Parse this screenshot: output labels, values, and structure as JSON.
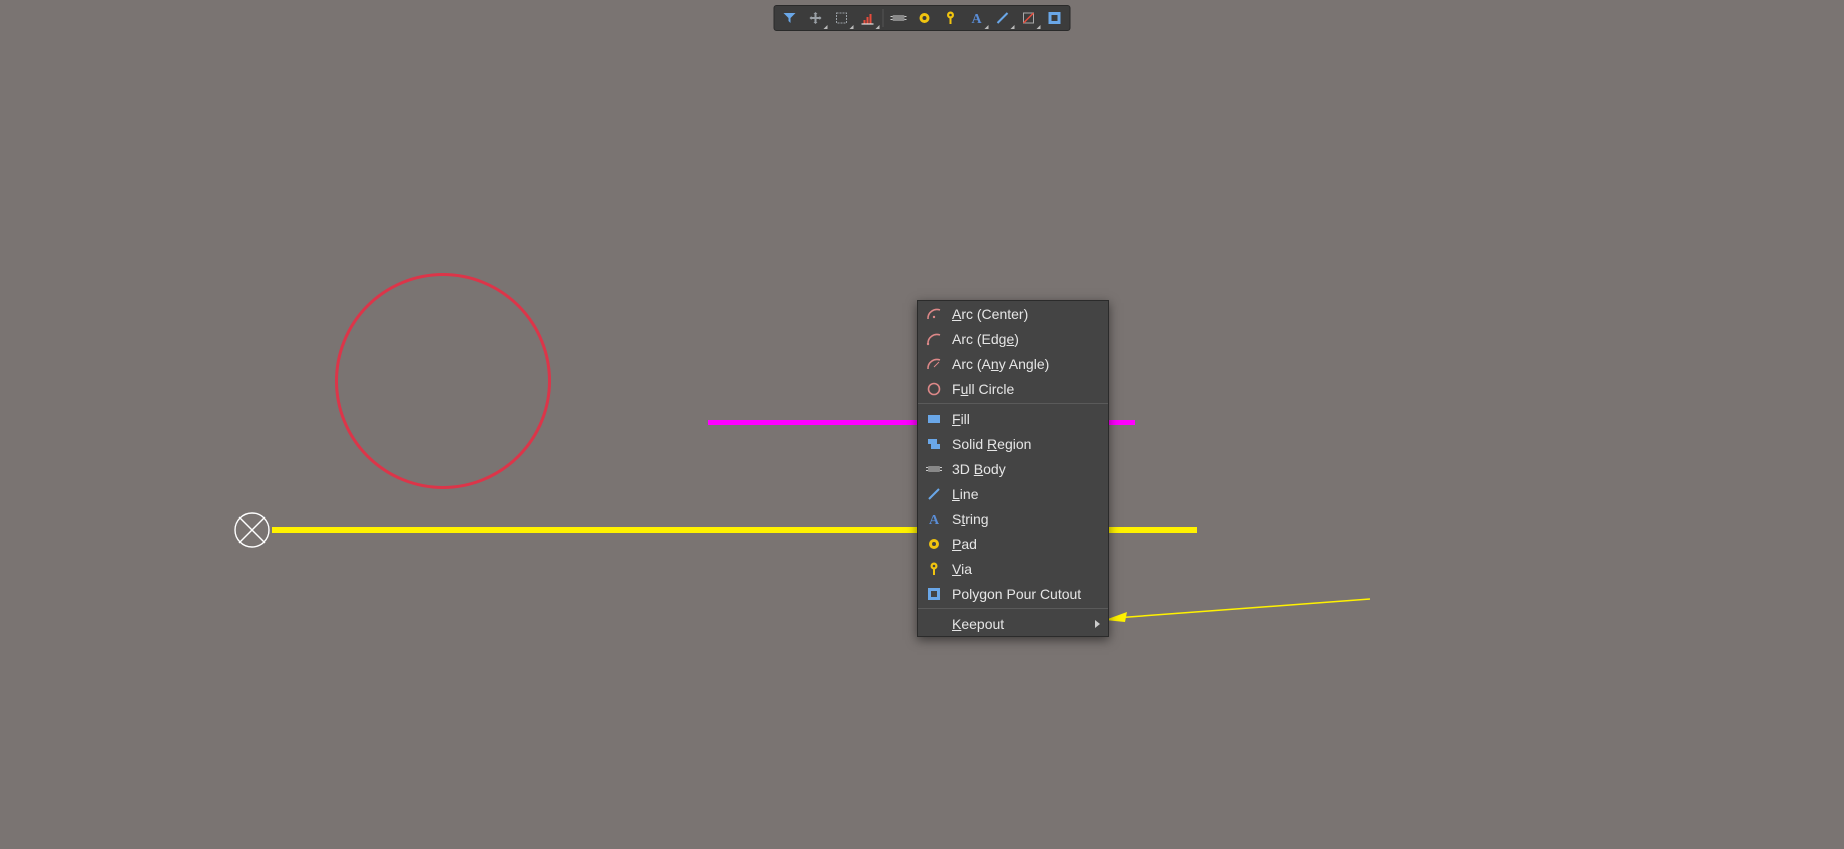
{
  "toolbar": {
    "items": [
      {
        "name": "filter-icon",
        "dropdown": false
      },
      {
        "name": "move-icon",
        "dropdown": true
      },
      {
        "name": "selection-icon",
        "dropdown": true
      },
      {
        "name": "align-icon",
        "dropdown": true
      },
      {
        "sep": true
      },
      {
        "name": "component-icon",
        "dropdown": false
      },
      {
        "name": "pad-icon",
        "dropdown": false
      },
      {
        "name": "via-icon",
        "dropdown": false
      },
      {
        "name": "text-icon",
        "dropdown": true
      },
      {
        "name": "line-icon",
        "dropdown": true
      },
      {
        "name": "shape-icon",
        "dropdown": true
      },
      {
        "name": "polygon-pour-cutout-icon",
        "dropdown": false
      }
    ]
  },
  "context_menu": {
    "groups": [
      {
        "items": [
          {
            "icon": "arc-center-icon",
            "label_pre": "",
            "label_u": "A",
            "label_post": "rc (Center)"
          },
          {
            "icon": "arc-edge-icon",
            "label_pre": "Arc (Edg",
            "label_u": "e",
            "label_post": ")"
          },
          {
            "icon": "arc-any-icon",
            "label_pre": "Arc (A",
            "label_u": "n",
            "label_post": "y Angle)"
          },
          {
            "icon": "full-circle-icon",
            "label_pre": "F",
            "label_u": "u",
            "label_post": "ll Circle"
          }
        ]
      },
      {
        "items": [
          {
            "icon": "fill-icon",
            "label_pre": "",
            "label_u": "F",
            "label_post": "ill"
          },
          {
            "icon": "solid-region-icon",
            "label_pre": "Solid ",
            "label_u": "R",
            "label_post": "egion"
          },
          {
            "icon": "3d-body-icon",
            "label_pre": "3D ",
            "label_u": "B",
            "label_post": "ody"
          },
          {
            "icon": "line-place-icon",
            "label_pre": "",
            "label_u": "L",
            "label_post": "ine"
          },
          {
            "icon": "string-icon",
            "label_pre": "S",
            "label_u": "t",
            "label_post": "ring"
          },
          {
            "icon": "pad-place-icon",
            "label_pre": "",
            "label_u": "P",
            "label_post": "ad"
          },
          {
            "icon": "via-place-icon",
            "label_pre": "",
            "label_u": "V",
            "label_post": "ia"
          },
          {
            "icon": "polygon-cutout-icon",
            "label_pre": "Polygon Pour Cutout",
            "label_u": "",
            "label_post": ""
          }
        ]
      },
      {
        "items": [
          {
            "icon": "",
            "label_pre": "",
            "label_u": "K",
            "label_post": "eepout",
            "submenu": true
          }
        ]
      }
    ]
  },
  "shapes": {
    "origin": "origin-marker",
    "circle": "red-outline-circle",
    "magenta": "magenta-track",
    "yellow": "yellow-track",
    "arrow": "annotation-arrow"
  }
}
